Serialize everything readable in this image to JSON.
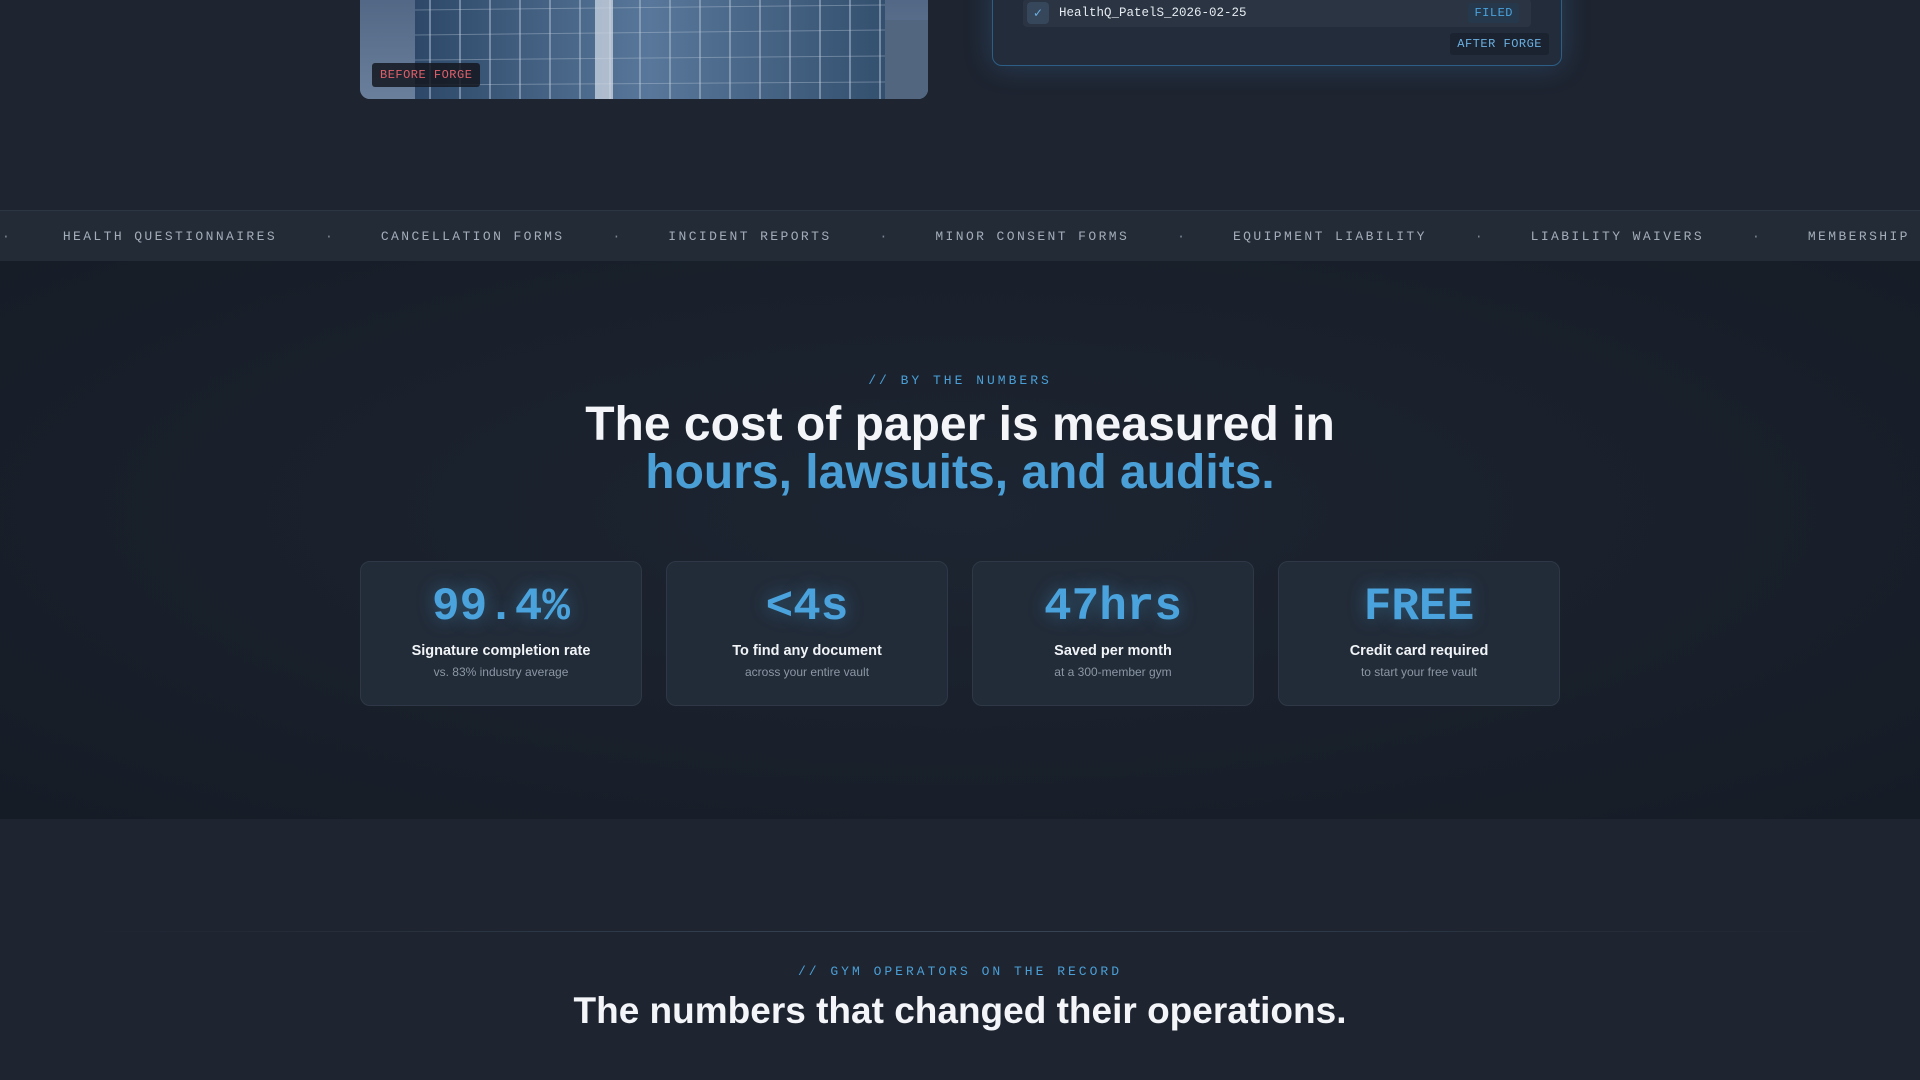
{
  "hero": {
    "before_label": "BEFORE FORGE",
    "after_label": "AFTER FORGE",
    "file_row": {
      "check": "✓",
      "file_name": "HealthQ_PatelS_2026-02-25",
      "status": "FILED"
    }
  },
  "ticker": {
    "separator": "·",
    "items": [
      "HEALTH QUESTIONNAIRES",
      "CANCELLATION FORMS",
      "INCIDENT REPORTS",
      "MINOR CONSENT FORMS",
      "EQUIPMENT LIABILITY",
      "LIABILITY WAIVERS",
      "MEMBERSHIP AGREEME"
    ]
  },
  "numbers": {
    "kicker": "// BY THE NUMBERS",
    "headline_line1": "The cost of paper is measured in",
    "headline_line2": "hours, lawsuits, and audits.",
    "stats": [
      {
        "value": "99.4%",
        "label": "Signature completion rate",
        "sub": "vs. 83% industry average"
      },
      {
        "value": "<4s",
        "label": "To find any document",
        "sub": "across your entire vault"
      },
      {
        "value": "47hrs",
        "label": "Saved per month",
        "sub": "at a 300-member gym"
      },
      {
        "value": "FREE",
        "label": "Credit card required",
        "sub": "to start your free vault"
      }
    ]
  },
  "testimonials": {
    "kicker": "// GYM OPERATORS ON THE RECORD",
    "headline": "The numbers that changed their operations."
  },
  "colors": {
    "accent": "#4a9fd6",
    "before_label": "#e0606a",
    "background": "#1e2430"
  }
}
